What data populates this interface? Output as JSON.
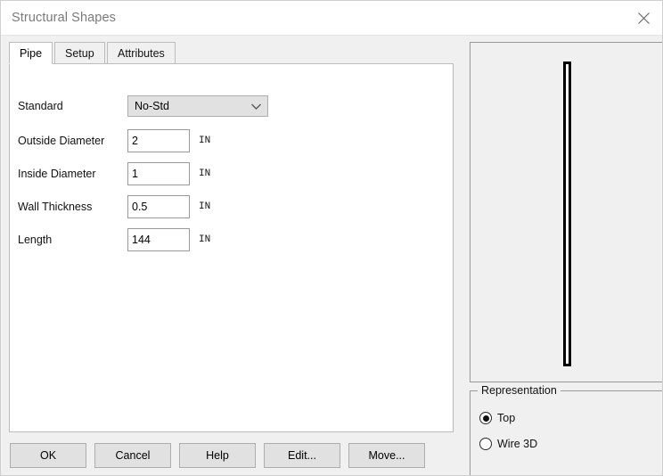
{
  "window": {
    "title": "Structural Shapes",
    "close_icon": "close-icon"
  },
  "tabs": [
    {
      "label": "Pipe",
      "active": true
    },
    {
      "label": "Setup",
      "active": false
    },
    {
      "label": "Attributes",
      "active": false
    }
  ],
  "form": {
    "standard": {
      "label": "Standard",
      "value": "No-Std",
      "arrow_icon": "chevron-down-icon"
    },
    "fields": [
      {
        "label": "Outside Diameter",
        "value": "2",
        "unit": "IN"
      },
      {
        "label": "Inside Diameter",
        "value": "1",
        "unit": "IN"
      },
      {
        "label": "Wall Thickness",
        "value": "0.5",
        "unit": "IN"
      },
      {
        "label": "Length",
        "value": "144",
        "unit": "IN"
      }
    ]
  },
  "buttons": [
    {
      "label": "OK"
    },
    {
      "label": "Cancel"
    },
    {
      "label": "Help"
    },
    {
      "label": "Edit..."
    },
    {
      "label": "Move..."
    }
  ],
  "preview": {
    "shape_name": "pipe-profile"
  },
  "representation": {
    "title": "Representation",
    "options": [
      {
        "label": "Top",
        "selected": true
      },
      {
        "label": "Wire 3D",
        "selected": false
      }
    ]
  },
  "colors": {
    "window_bg": "#f0f0f0",
    "panel_bg": "#ffffff",
    "title_text": "#7a7a7a",
    "border": "#bcbcbc",
    "button_bg": "#e1e1e1"
  }
}
